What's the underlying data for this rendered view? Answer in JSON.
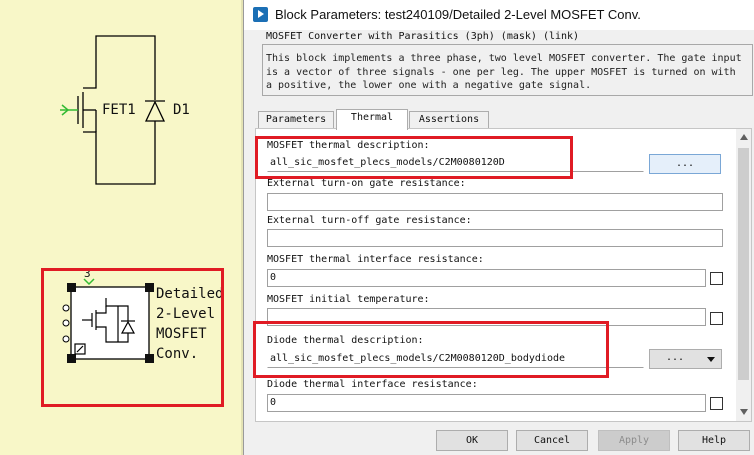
{
  "schematic": {
    "fet_label": "FET1",
    "diode_label": "D1",
    "block_label_lines": [
      "Detailed",
      "2-Level",
      "MOSFET",
      "Conv."
    ],
    "block_port_number": "3",
    "colors": {
      "canvas": "#f8f7c8",
      "wire": "#000000",
      "port": "#33bb33",
      "highlight": "#e01b24"
    }
  },
  "dialog": {
    "title": "Block Parameters: test240109/Detailed 2-Level MOSFET Conv.",
    "mask_type": "MOSFET Converter with Parasitics (3ph) (mask) (link)",
    "description": "This block implements a three phase, two level MOSFET converter. The gate input\nis a vector of three signals - one per leg. The upper MOSFET is turned on with\na positive, the lower one with a negative gate signal.",
    "tabs": [
      {
        "label": "Parameters",
        "active": false
      },
      {
        "label": "Thermal",
        "active": true
      },
      {
        "label": "Assertions",
        "active": false
      }
    ],
    "params": {
      "mosfet_thermal_description": {
        "label": "MOSFET thermal description:",
        "value": "all_sic_mosfet_plecs_models/C2M0080120D",
        "button": "..."
      },
      "ext_turn_on_gate_resistance": {
        "label": "External turn-on gate resistance:",
        "value": ""
      },
      "ext_turn_off_gate_resistance": {
        "label": "External turn-off gate resistance:",
        "value": ""
      },
      "mosfet_thermal_interface_resistance": {
        "label": "MOSFET thermal interface resistance:",
        "value": "0",
        "checked": false
      },
      "mosfet_initial_temperature": {
        "label": "MOSFET initial temperature:",
        "value": "",
        "checked": false
      },
      "diode_thermal_description": {
        "label": "Diode thermal description:",
        "value": "all_sic_mosfet_plecs_models/C2M0080120D_bodydiode",
        "button": "..."
      },
      "diode_thermal_interface_resistance": {
        "label": "Diode thermal interface resistance:",
        "value": "0",
        "checked": false
      }
    },
    "buttons": {
      "ok": "OK",
      "cancel": "Cancel",
      "apply": "Apply",
      "help": "Help"
    }
  }
}
